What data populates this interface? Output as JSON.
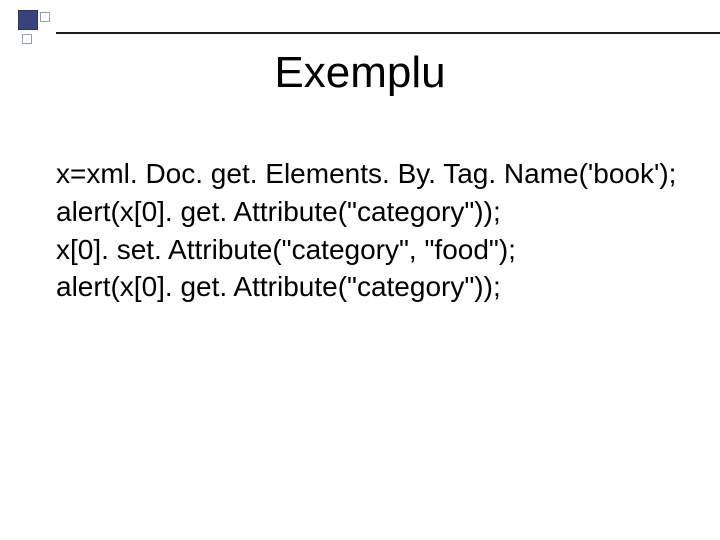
{
  "slide": {
    "title": "Exemplu",
    "code_lines": [
      "x=xml. Doc. get. Elements. By. Tag. Name('book');",
      "alert(x[0]. get. Attribute(\"category\"));",
      "x[0]. set. Attribute(\"category\", \"food\");",
      "alert(x[0]. get. Attribute(\"category\"));"
    ]
  }
}
